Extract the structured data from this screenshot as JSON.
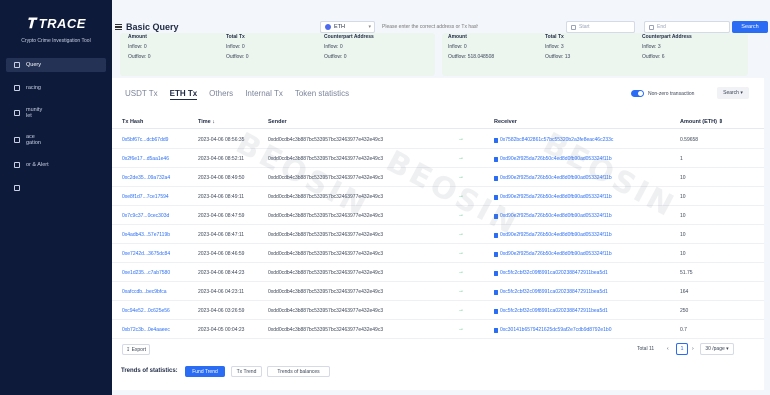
{
  "app": {
    "logo_text": "TRACE",
    "tagline": "Crypto Crime Investigation Tool",
    "nav": [
      {
        "label": "Query",
        "active": true
      },
      {
        "label": "racing",
        "active": false
      },
      {
        "label": "munity\nlet",
        "active": false
      },
      {
        "label": "ace\ngation",
        "active": false
      },
      {
        "label": "or & Alert",
        "active": false
      },
      {
        "label": "",
        "active": false
      }
    ]
  },
  "header": {
    "title": "Basic Query",
    "chain": "ETH",
    "search_placeholder": "Please enter the correct address or Tx hash",
    "start_placeholder": "Start",
    "end_placeholder": "End",
    "search_button": "Search"
  },
  "summary": {
    "left": {
      "amount_head": "Amount",
      "total_head": "Total Tx",
      "cp_head": "Counterpart Address",
      "amount_in": "Inflow: 0",
      "amount_out": "Outflow: 0",
      "total_in": "Inflow: 0",
      "total_out": "Outflow: 0",
      "cp_in": "Inflow: 0",
      "cp_out": "Outflow: 0"
    },
    "right": {
      "amount_head": "Amount",
      "total_head": "Total Tx",
      "cp_head": "Counterpart Address",
      "amount_in": "Inflow: 0",
      "amount_out": "Outflow: 518.048508",
      "total_in": "Inflow: 3",
      "total_out": "Outflow: 13",
      "cp_in": "Inflow: 3",
      "cp_out": "Outflow: 6"
    }
  },
  "tabs": [
    "USDT Tx",
    "ETH Tx",
    "Others",
    "Internal Tx",
    "Token statistics"
  ],
  "active_tab": "ETH Tx",
  "toggle_label": "Non-zero transaction",
  "search_dropdown": "Search",
  "table": {
    "headers": {
      "hash": "Tx Hash",
      "time": "Time",
      "sender": "Sender",
      "receiver": "Receiver",
      "amount": "Amount (ETH)"
    },
    "rows": [
      {
        "hash": "0x5bf67c...dcb67dd9",
        "time": "2023-04-06 08:56:35",
        "sender": "0xdd0cdb4c3b887bc533957bc32463977e432e49c3",
        "receiver": "0x7582bc8402861c57bc55320b2a3fe8eac46c233c",
        "amount": "0.59658"
      },
      {
        "hash": "0x2f6e17...d5aa1e46",
        "time": "2023-04-06 08:52:11",
        "sender": "0xdd0cdb4c3b887bc533957bc32463977e432e49c3",
        "receiver": "0xd90e2f925da726b50c4ed8d0fb90ad053324f11b",
        "amount": "1"
      },
      {
        "hash": "0xc2de35...09a732a4",
        "time": "2023-04-06 08:49:50",
        "sender": "0xdd0cdb4c3b887bc533957bc32463977e432e49c3",
        "receiver": "0xd90e2f925da726b50c4ed8d0fb90ad053324f11b",
        "amount": "10"
      },
      {
        "hash": "0xe8f1d7...7ce17594",
        "time": "2023-04-06 08:49:11",
        "sender": "0xdd0cdb4c3b887bc533957bc32463977e432e49c3",
        "receiver": "0xd90e2f925da726b50c4ed8d0fb90ad053324f11b",
        "amount": "10"
      },
      {
        "hash": "0x7c9c37...0cec303d",
        "time": "2023-04-06 08:47:59",
        "sender": "0xdd0cdb4c3b887bc533957bc32463977e432e49c3",
        "receiver": "0xd90e2f925da726b50c4ed8d0fb90ad053324f11b",
        "amount": "10"
      },
      {
        "hash": "0x4adb43...57e7119b",
        "time": "2023-04-06 08:47:11",
        "sender": "0xdd0cdb4c3b887bc533957bc32463977e432e49c3",
        "receiver": "0xd90e2f925da726b50c4ed8d0fb90ad053324f11b",
        "amount": "10"
      },
      {
        "hash": "0xe7242d...3675dc84",
        "time": "2023-04-06 08:46:59",
        "sender": "0xdd0cdb4c3b887bc533957bc32463977e432e49c3",
        "receiver": "0xd90e2f925da726b50c4ed8d0fb90ad053324f11b",
        "amount": "10"
      },
      {
        "hash": "0xe1d235...c7ab7580",
        "time": "2023-04-06 08:44:23",
        "sender": "0xdd0cdb4c3b887bc533957bc32463977e432e49c3",
        "receiver": "0xc5fc2cbf32c09f8991ca0202388472911bea5d1",
        "amount": "51.75"
      },
      {
        "hash": "0xafccdb...bec9bfca",
        "time": "2023-04-06 04:23:11",
        "sender": "0xdd0cdb4c3b887bc533957bc32463977e432e49c3",
        "receiver": "0xc5fc2cbf32c09f8991ca0202388472911bea5d1",
        "amount": "164"
      },
      {
        "hash": "0xc94e52...0c625e56",
        "time": "2023-04-06 03:26:59",
        "sender": "0xdd0cdb4c3b887bc533957bc32463977e432e49c3",
        "receiver": "0xc5fc2cbf32c09f8991ca0202388472911bea5d1",
        "amount": "250"
      },
      {
        "hash": "0xb72c3b...0e4aaeec",
        "time": "2023-04-05 00:04:23",
        "sender": "0xdd0cdb4c3b887bc533957bc32463977e432e49c3",
        "receiver": "0xc30141b6579421625dc59af2e7cdb9d8792e1b0",
        "amount": "0.7"
      }
    ]
  },
  "footer": {
    "export": "Export",
    "total": "Total 11",
    "page": "1",
    "per_page": "30 /page",
    "trends_label": "Trends of statistics:",
    "trend_buttons": [
      "Fund Trend",
      "Tx Trend",
      "Trends of balances"
    ]
  },
  "watermark": "BEOSIN",
  "colors": {
    "accent": "#2a6df4",
    "sidebar": "#0e1a3a",
    "inflow_arrow": "#2fbf71"
  }
}
